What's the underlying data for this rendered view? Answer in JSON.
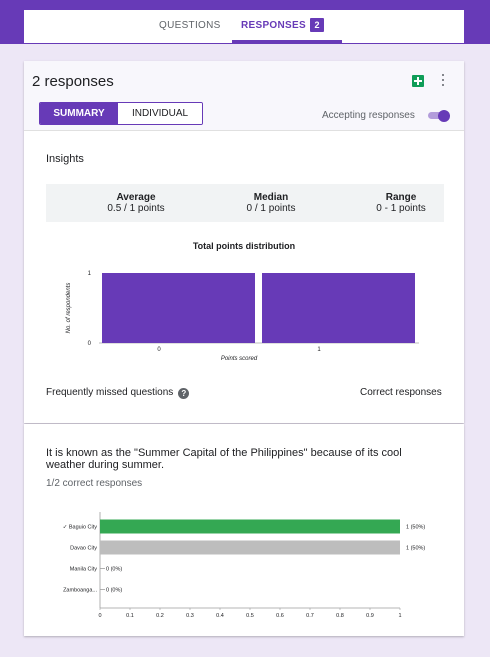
{
  "tabs": {
    "questions_label": "QUESTIONS",
    "responses_label": "RESPONSES",
    "responses_count": "2"
  },
  "summary_card": {
    "title": "2 responses",
    "summary_label": "SUMMARY",
    "individual_label": "INDIVIDUAL",
    "accepting_label": "Accepting responses",
    "accepting_on": true,
    "sheets_icon": "google-sheets-icon",
    "more_icon": "more-vert-icon"
  },
  "insights": {
    "title": "Insights",
    "average_label": "Average",
    "average_value": "0.5 / 1 points",
    "median_label": "Median",
    "median_value": "0 / 1 points",
    "range_label": "Range",
    "range_value": "0 - 1 points",
    "missed_label": "Frequently missed questions",
    "correct_label": "Correct responses"
  },
  "chart_data": [
    {
      "type": "bar",
      "title": "Total points distribution",
      "xlabel": "Points scored",
      "ylabel": "No. of respondents",
      "categories": [
        "0",
        "1"
      ],
      "values": [
        1,
        1
      ],
      "ylim": [
        0,
        1
      ],
      "y_ticks": [
        "0",
        "1"
      ],
      "color": "#673ab7"
    },
    {
      "type": "bar",
      "orientation": "horizontal",
      "categories": [
        "✓ Baguio City",
        "Davao City",
        "Manila City",
        "Zamboanga..."
      ],
      "values": [
        1,
        1,
        0,
        0
      ],
      "value_labels": [
        "1 (50%)",
        "1 (50%)",
        "0 (0%)",
        "0 (0%)"
      ],
      "bar_colors": [
        "#34a853",
        "#bdbdbd",
        "#bdbdbd",
        "#bdbdbd"
      ],
      "xlim": [
        0,
        1
      ],
      "x_ticks": [
        "0",
        "0.1",
        "0.2",
        "0.3",
        "0.4",
        "0.5",
        "0.6",
        "0.7",
        "0.8",
        "0.9",
        "1"
      ]
    }
  ],
  "question": {
    "text": "It is known as the \"Summer Capital of the Philippines\" because of its cool weather during summer.",
    "correct_summary": "1/2 correct responses"
  },
  "colors": {
    "accent": "#673ab7",
    "correct": "#34a853",
    "neutral": "#bdbdbd"
  }
}
